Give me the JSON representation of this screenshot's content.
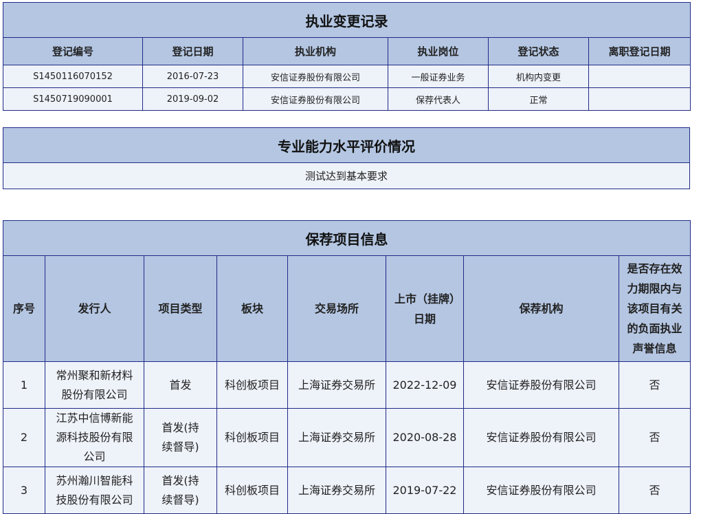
{
  "practice_record": {
    "title": "执业变更记录",
    "headers": [
      "登记编号",
      "登记日期",
      "执业机构",
      "执业岗位",
      "登记状态",
      "离职登记日期"
    ],
    "rows": [
      [
        "S1450116070152",
        "2016-07-23",
        "安信证券股份有限公司",
        "一般证券业务",
        "机构内变更",
        ""
      ],
      [
        "S1450719090001",
        "2019-09-02",
        "安信证券股份有限公司",
        "保荐代表人",
        "正常",
        ""
      ]
    ]
  },
  "competence": {
    "title": "专业能力水平评价情况",
    "text": "测试达到基本要求"
  },
  "sponsor_projects": {
    "title": "保荐项目信息",
    "headers": [
      "序号",
      "发行人",
      "项目类型",
      "板块",
      "交易场所",
      "上市（挂牌）日期",
      "保荐机构",
      "是否存在效力期限内与该项目有关的负面执业声誉信息"
    ],
    "rows": [
      [
        "1",
        "常州聚和新材料股份有限公司",
        "首发",
        "科创板项目",
        "上海证券交易所",
        "2022-12-09",
        "安信证券股份有限公司",
        "否"
      ],
      [
        "2",
        "江苏中信博新能源科技股份有限公司",
        "首发(持续督导)",
        "科创板项目",
        "上海证券交易所",
        "2020-08-28",
        "安信证券股份有限公司",
        "否"
      ],
      [
        "3",
        "苏州瀚川智能科技股份有限公司",
        "首发(持续督导)",
        "科创板项目",
        "上海证券交易所",
        "2019-07-22",
        "安信证券股份有限公司",
        "否"
      ]
    ]
  }
}
